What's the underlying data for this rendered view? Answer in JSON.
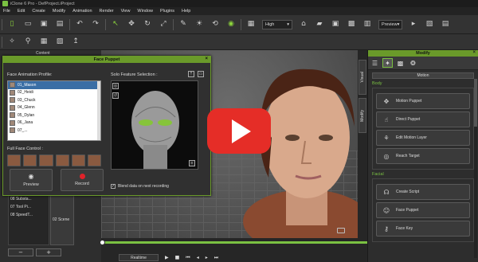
{
  "window": {
    "title": "iClone 6 Pro - DefProject.iProject"
  },
  "menu": [
    "File",
    "Edit",
    "Create",
    "Modify",
    "Animation",
    "Render",
    "View",
    "Window",
    "Plugins",
    "Help"
  ],
  "toolbar": {
    "quality_value": "High",
    "preview_value": "Preview"
  },
  "left_panel": {
    "tab_label": "Content"
  },
  "content_list": [
    "08 Substa...",
    "07 Tool Pi...",
    "08 SpeedT..."
  ],
  "content_thumb_label": "02 Scene",
  "left_buttons": [
    "−",
    "+"
  ],
  "face_puppet": {
    "title": "Face Puppet",
    "profile_label": "Face Animation Profile:",
    "solo_label": "Solo Feature Selection :",
    "profiles": [
      "01_Mason",
      "02_Heidi",
      "03_Chuck",
      "04_Glenn",
      "05_Dylan",
      "06_Jana",
      "07_..."
    ],
    "selected_index": 0,
    "full_face_label": "Full Face Control :",
    "preview_label": "Preview",
    "record_label": "Record",
    "blend_label": "Blend data on next recording",
    "blend_checked": true
  },
  "side_tabs": [
    "Visual",
    "Modify"
  ],
  "modify": {
    "title": "Modify",
    "motion_label": "Motion",
    "body_label": "Body",
    "body_buttons": [
      "Motion Puppet",
      "Direct Puppet",
      "Edit Motion Layer",
      "Reach Target"
    ],
    "facial_label": "Facial",
    "facial_buttons": [
      "Create Script",
      "Face Puppet",
      "Face Key"
    ]
  },
  "timeline": {
    "realtime_label": "Realtime"
  },
  "colors": {
    "accent": "#7ac142",
    "header_green": "#6a9a2a",
    "play": "#e52d27"
  }
}
